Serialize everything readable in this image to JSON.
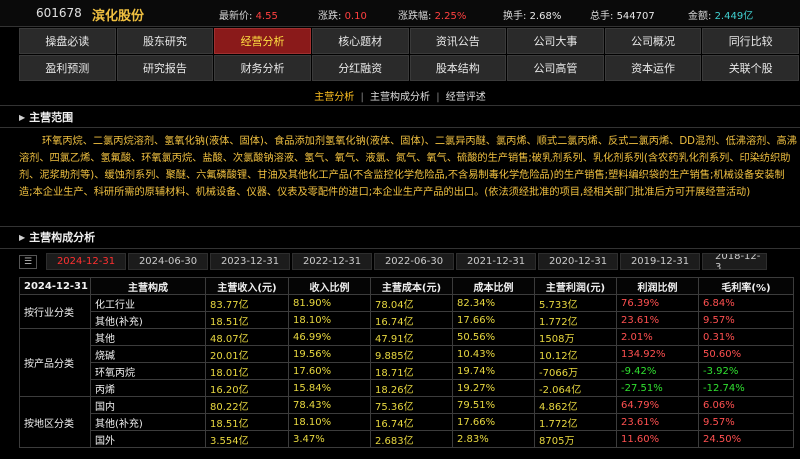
{
  "quote": {
    "code": "601678",
    "name": "滨化股份",
    "price_label": "最新价:",
    "price": "4.55",
    "change_label": "涨跌:",
    "change": "0.10",
    "change_pct_label": "涨跌幅:",
    "change_pct": "2.25%",
    "turnover_label": "换手:",
    "turnover": "2.68%",
    "volume_label": "总手:",
    "volume": "544707",
    "amount_label": "金额:",
    "amount": "2.449亿"
  },
  "nav": {
    "row1": [
      "操盘必读",
      "股东研究",
      "经营分析",
      "核心题材",
      "资讯公告",
      "公司大事",
      "公司概况",
      "同行比较"
    ],
    "row2": [
      "盈利预测",
      "研究报告",
      "财务分析",
      "分红融资",
      "股本结构",
      "公司高管",
      "资本运作",
      "关联个股"
    ],
    "active": "经营分析"
  },
  "sublinks": {
    "items": [
      "主营分析",
      "主营构成分析",
      "经营评述"
    ],
    "separator": "|"
  },
  "scope": {
    "title": "主营范围",
    "text": "环氧丙烷、二氯丙烷溶剂、氢氧化钠(液体、固体)、食品添加剂氢氧化钠(液体、固体)、二氯异丙醚、氯丙烯、顺式二氯丙烯、反式二氯丙烯、DD混剂、低沸溶剂、高沸溶剂、四氯乙烯、氢氟酸、环氧氯丙烷、盐酸、次氯酸钠溶液、氢气、氧气、液氯、氮气、氧气、硫酸的生产销售;破乳剂系列、乳化剂系列(含农药乳化剂系列、印染纺织助剂、泥浆助剂等)、缓蚀剂系列、聚醚、六氟磷酸锂、甘油及其他化工产品(不含监控化学危险品,不含易制毒化学危险品)的生产销售;塑料编织袋的生产销售;机械设备安装制造;本企业生产、科研所需的原辅材料、机械设备、仪器、仪表及零配件的进口;本企业生产产品的出口。(依法须经批准的项目,经相关部门批准后方可开展经营活动)"
  },
  "composition": {
    "title": "主营构成分析",
    "dates": [
      "2024-12-31",
      "2024-06-30",
      "2023-12-31",
      "2022-12-31",
      "2022-06-30",
      "2021-12-31",
      "2020-12-31",
      "2019-12-31",
      "2018-12-3"
    ],
    "active_date": "2024-12-31",
    "headers": [
      "2024-12-31",
      "主营构成",
      "主营收入(元)",
      "收入比例",
      "主营成本(元)",
      "成本比例",
      "主营利润(元)",
      "利润比例",
      "毛利率(%)"
    ],
    "groups": [
      {
        "category": "按行业分类",
        "rows": [
          [
            "化工行业",
            "83.77亿",
            "81.90%",
            "78.04亿",
            "82.34%",
            "5.733亿",
            "76.39%",
            "6.84%"
          ],
          [
            "其他(补充)",
            "18.51亿",
            "18.10%",
            "16.74亿",
            "17.66%",
            "1.772亿",
            "23.61%",
            "9.57%"
          ]
        ]
      },
      {
        "category": "按产品分类",
        "rows": [
          [
            "其他",
            "48.07亿",
            "46.99%",
            "47.91亿",
            "50.56%",
            "1508万",
            "2.01%",
            "0.31%"
          ],
          [
            "烧碱",
            "20.01亿",
            "19.56%",
            "9.885亿",
            "10.43%",
            "10.12亿",
            "134.92%",
            "50.60%"
          ],
          [
            "环氧丙烷",
            "18.01亿",
            "17.60%",
            "18.71亿",
            "19.74%",
            "-7066万",
            "-9.42%",
            "-3.92%"
          ],
          [
            "丙烯",
            "16.20亿",
            "15.84%",
            "18.26亿",
            "19.27%",
            "-2.064亿",
            "-27.51%",
            "-12.74%"
          ]
        ]
      },
      {
        "category": "按地区分类",
        "rows": [
          [
            "国内",
            "80.22亿",
            "78.43%",
            "75.36亿",
            "79.51%",
            "4.862亿",
            "64.79%",
            "6.06%"
          ],
          [
            "其他(补充)",
            "18.51亿",
            "18.10%",
            "16.74亿",
            "17.66%",
            "1.772亿",
            "23.61%",
            "9.57%"
          ],
          [
            "国外",
            "3.554亿",
            "3.47%",
            "2.683亿",
            "2.83%",
            "8705万",
            "11.60%",
            "24.50%"
          ]
        ]
      }
    ]
  },
  "colors": {
    "brand_name": "#f0c040",
    "up": "#ff4040",
    "down": "#30e030",
    "value": "#e8d840",
    "active_tab_bg": "#8a1a1a"
  }
}
